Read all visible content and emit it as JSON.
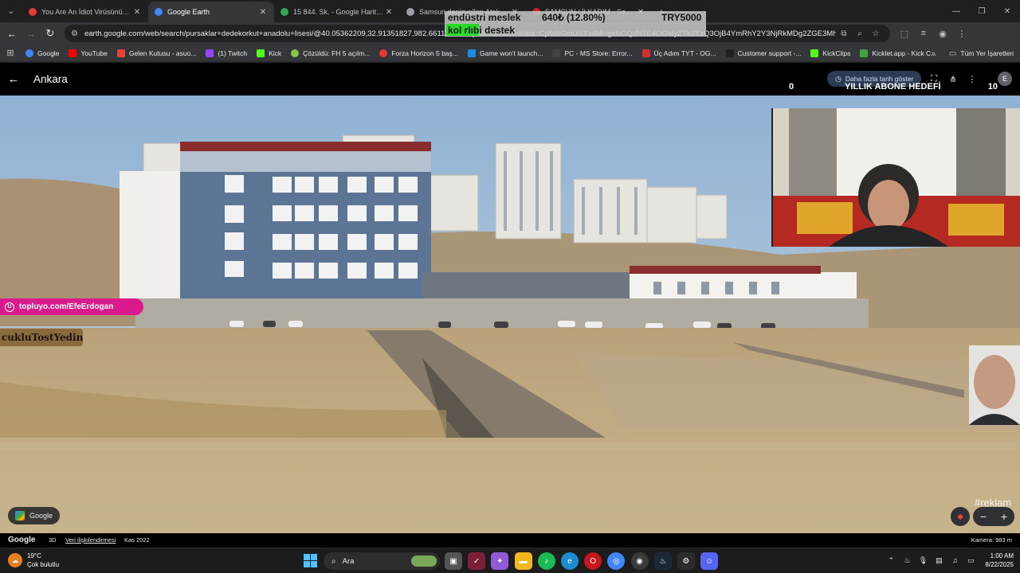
{
  "browser": {
    "tabs": [
      {
        "title": "You Are An İdiot Virüsünün Hik",
        "color": "#e53935",
        "active": false
      },
      {
        "title": "Google Earth",
        "color": "#4285f4",
        "active": true
      },
      {
        "title": "15 844. Sk. - Google Haritalar",
        "color": "#34a853",
        "active": false
      },
      {
        "title": "Samsun denizyolları Atakum sa",
        "color": "#9aa0a6",
        "active": false
      },
      {
        "title": "SAMSUN / İLKADIM - Samsun",
        "color": "#c62828",
        "active": false
      }
    ],
    "url": "earth.google.com/web/search/pursaklar+dedekorkut+anadolu+lisesi/@40.05362209,32.91351827,982.66113373a,0y,58.55h,0t,0r/data=CpMBGmUSXxIlMHgxNGQzNTE4OGMyZTk3YzQ3OjB4YmRhY2Y3NjRkMDg2ZGE3MhkMDg2N2QzNWQ5MmI1OjB4ZGYwZmJmMmRhY2",
    "bookmarks": [
      {
        "label": "Google",
        "color": "#4285f4"
      },
      {
        "label": "YouTube",
        "color": "#ff0000"
      },
      {
        "label": "Gelen Kutusu - asuo...",
        "color": "#ea4335"
      },
      {
        "label": "(1) Twitch",
        "color": "#9146ff"
      },
      {
        "label": "Kick",
        "color": "#53fc18"
      },
      {
        "label": "Çözüldü: FH 5 açılm...",
        "color": "#8bc34a"
      },
      {
        "label": "Forza Horizon 5 baş...",
        "color": "#e53935"
      },
      {
        "label": "Game won't launch...",
        "color": "#1e88e5"
      },
      {
        "label": "PC - MS Store: Error...",
        "color": "#444444"
      },
      {
        "label": "Üç Adım TYT - OG...",
        "color": "#d32f2f"
      },
      {
        "label": "Customer support -...",
        "color": "#212121"
      },
      {
        "label": "KickClips",
        "color": "#53fc18"
      },
      {
        "label": "Kicklet.app - Kick C...",
        "color": "#43a047"
      }
    ],
    "all_bookmarks": "Tüm Yer İşaretleri"
  },
  "earth": {
    "place": "Ankara",
    "history_button": "Daha fazla tarih göster",
    "attribution": "Google",
    "mode_3d": "3D",
    "data_attribution": "Veri ilişkilendirmesi",
    "imagery_date": "Kas 2022",
    "camera": "Kamera: 983 m",
    "avatar_letter": "E",
    "google_button": "Google"
  },
  "overlays": {
    "goal_current": "0",
    "goal_title": "YILLIK ABONE HEDEFİ",
    "goal_target": "10",
    "donate_line1": "endüstri meslek",
    "donate_line2": "kol rlıbi destek",
    "donate_amount": "640₺ (12.80%)",
    "donate_target": "TRY5000",
    "donate_progress_pct": 12.8,
    "promo_link": "topluyo.com/EfeErdogan",
    "sign_text": "cukluTostYedin",
    "reklam": "#reklam"
  },
  "taskbar": {
    "weather_temp": "19°C",
    "weather_desc": "Çok bulutlu",
    "search_label": "Ara",
    "time": "1:00 AM",
    "date": "8/22/2025"
  },
  "colors": {
    "promo": "#d91a8c",
    "donate_bar": "#22dd22",
    "chrome_dark": "#202124"
  }
}
